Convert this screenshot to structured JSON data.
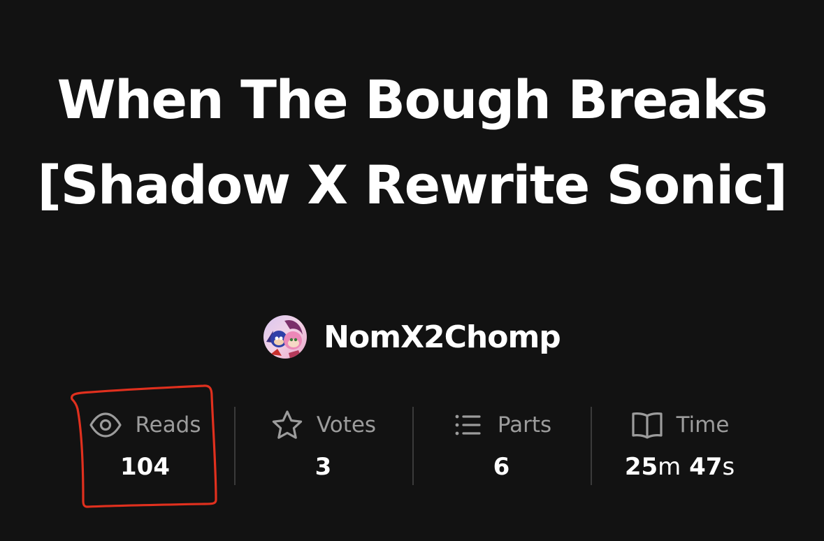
{
  "story": {
    "title": "When The Bough Breaks [Shadow X Rewrite Sonic]",
    "author": "NomX2Chomp"
  },
  "stats": [
    {
      "label": "Reads",
      "value": "104",
      "icon": "eye-icon"
    },
    {
      "label": "Votes",
      "value": "3",
      "icon": "star-icon"
    },
    {
      "label": "Parts",
      "value": "6",
      "icon": "list-icon"
    },
    {
      "label": "Time",
      "minutes": "25",
      "minutes_unit": "m",
      "seconds": "47",
      "seconds_unit": "s",
      "icon": "book-icon"
    }
  ],
  "colors": {
    "background": "#121212",
    "text": "#ffffff",
    "muted": "#9c9c9c",
    "divider": "#3a3a3a",
    "annotation": "#e0301e"
  }
}
